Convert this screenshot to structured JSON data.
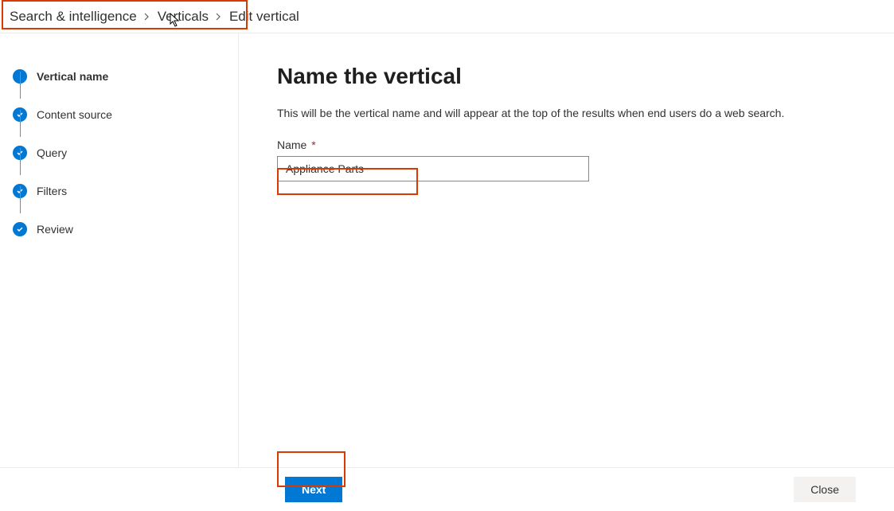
{
  "breadcrumb": {
    "items": [
      {
        "label": "Search & intelligence"
      },
      {
        "label": "Verticals"
      }
    ],
    "current": "Edit vertical"
  },
  "sidebar": {
    "steps": [
      {
        "label": "Vertical name",
        "state": "current"
      },
      {
        "label": "Content source",
        "state": "done"
      },
      {
        "label": "Query",
        "state": "done"
      },
      {
        "label": "Filters",
        "state": "done"
      },
      {
        "label": "Review",
        "state": "done"
      }
    ]
  },
  "main": {
    "title": "Name the vertical",
    "description": "This will be the vertical name and will appear at the top of the results when end users do a web search.",
    "name_label": "Name",
    "required_mark": "*",
    "name_value": "Appliance Parts"
  },
  "footer": {
    "next_label": "Next",
    "close_label": "Close"
  },
  "colors": {
    "primary": "#0078d4",
    "annotation": "#d83b01"
  }
}
